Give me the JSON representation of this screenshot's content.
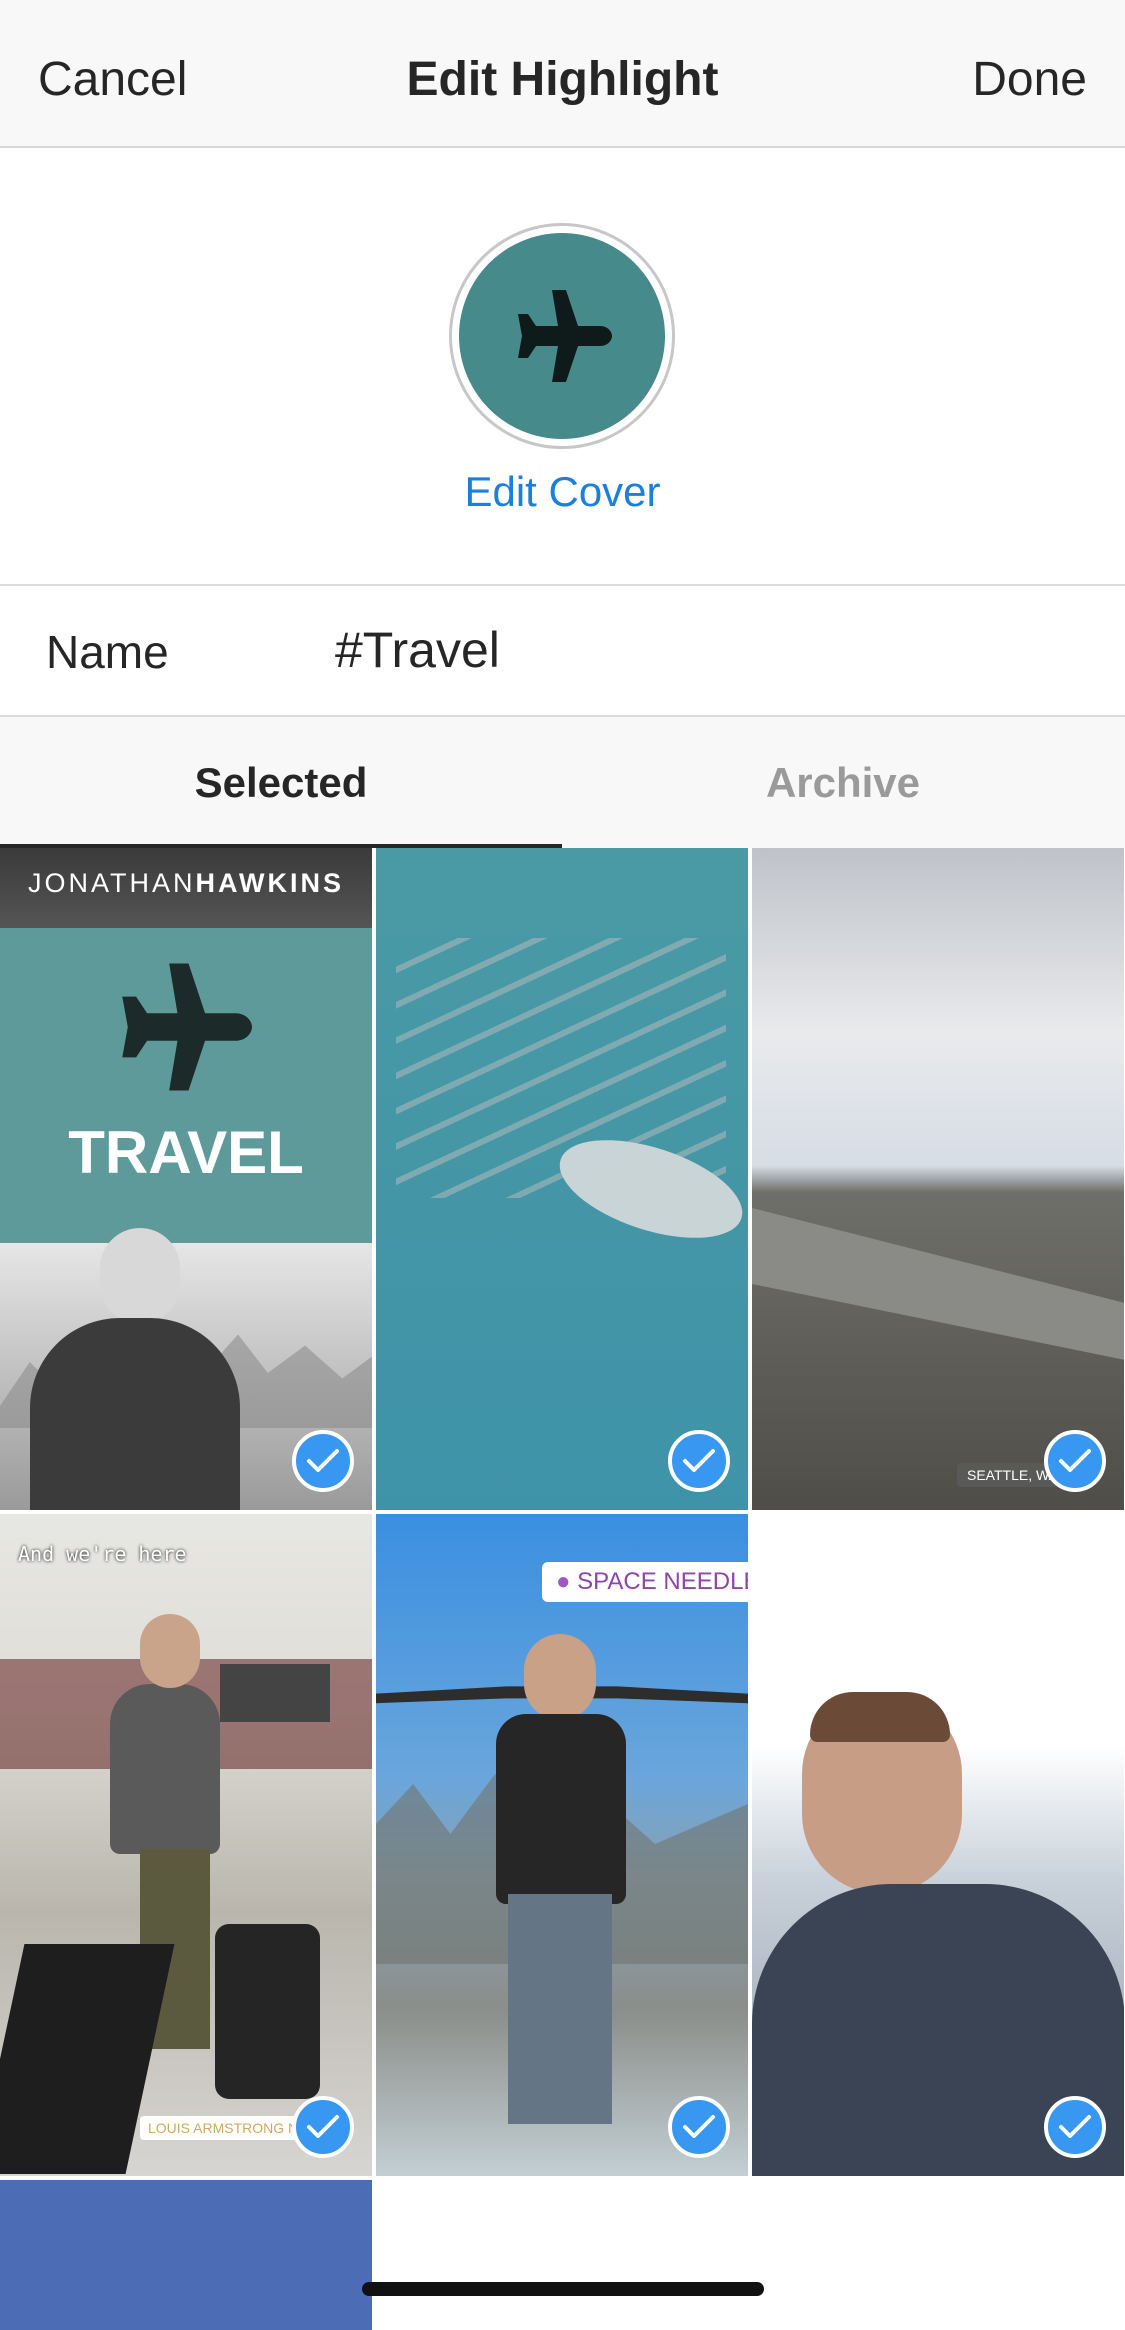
{
  "header": {
    "cancel_label": "Cancel",
    "title": "Edit Highlight",
    "done_label": "Done"
  },
  "cover": {
    "icon": "airplane-icon",
    "edit_label": "Edit Cover",
    "color": "#468a8c"
  },
  "name_field": {
    "label": "Name",
    "value": "#Travel"
  },
  "tabs": [
    {
      "label": "Selected",
      "active": true
    },
    {
      "label": "Archive",
      "active": false
    }
  ],
  "stories": [
    {
      "banner": "JONATHANHAWKINS",
      "banner_light": "JONATHAN",
      "banner_bold": "HAWKINS",
      "title": "TRAVEL",
      "selected": true
    },
    {
      "selected": true
    },
    {
      "location_sticker": "SEATTLE, WA",
      "selected": true
    },
    {
      "caption": "And we're here",
      "location_sticker": "LOUIS ARMSTRONG NEW O",
      "selected": true
    },
    {
      "location_sticker": "SPACE NEEDLE",
      "selected": true
    },
    {
      "selected": true
    }
  ],
  "colors": {
    "accent_blue": "#3897f0",
    "link_blue": "#1b7fe0"
  }
}
